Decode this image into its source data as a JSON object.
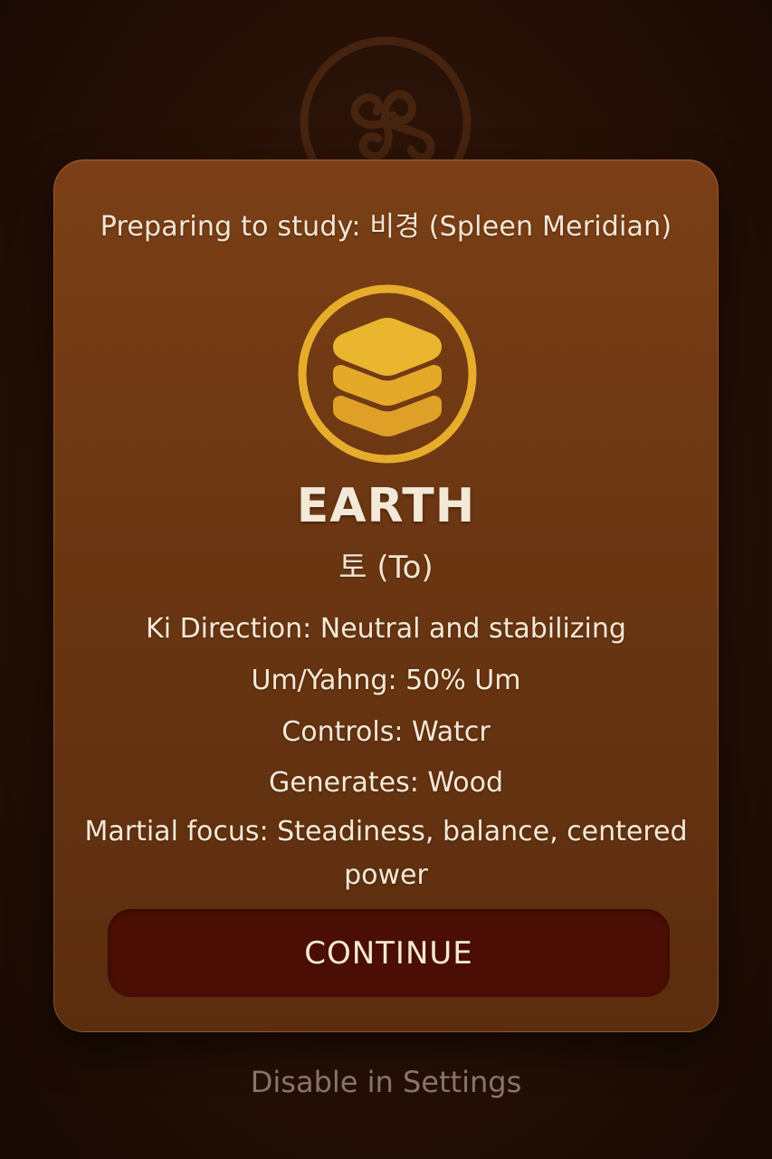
{
  "dialog": {
    "heading": "Preparing to study: 비경 (Spleen Meridian)",
    "element_icon": "earth-layers-icon",
    "element_name": "EARTH",
    "element_subtitle": "토 (To)",
    "details": [
      "Ki Direction: Neutral and stabilizing",
      "Um/Yahng: 50% Um",
      "Controls: Watcr",
      "Generates: Wood",
      "Martial focus: Steadiness, balance, centered power"
    ],
    "continue_label": "CONTINUE"
  },
  "footer": {
    "disable_label": "Disable in Settings"
  },
  "background": {
    "emblem_icon": "triskele-icon"
  },
  "colors": {
    "accent_gold": "#e6b02e",
    "card": "#6c3713",
    "button": "#4a0e04"
  }
}
